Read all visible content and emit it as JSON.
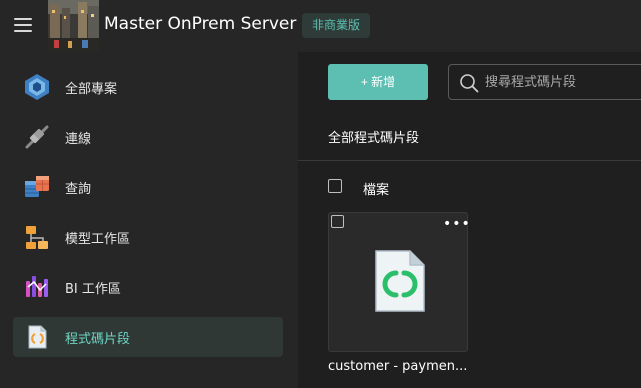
{
  "header": {
    "menu_icon": "hamburger-menu-icon",
    "server_title": "Master OnPrem Server",
    "badge": "非商業版"
  },
  "sidebar": {
    "items": [
      {
        "label": "全部專案",
        "icon": "all-projects-icon",
        "active": false
      },
      {
        "label": "連線",
        "icon": "connection-plug-icon",
        "active": false
      },
      {
        "label": "查詢",
        "icon": "query-table-icon",
        "active": false
      },
      {
        "label": "模型工作區",
        "icon": "model-workspace-icon",
        "active": false
      },
      {
        "label": "BI 工作區",
        "icon": "bi-workspace-icon",
        "active": false
      },
      {
        "label": "程式碼片段",
        "icon": "code-snippet-icon",
        "active": true
      }
    ]
  },
  "main": {
    "new_button": "+ 新增",
    "search": {
      "placeholder": "搜尋程式碼片段",
      "value": ""
    },
    "section_title": "全部程式碼片段",
    "column_header": "檔案",
    "cards": [
      {
        "name": "customer - paymen...",
        "icon": "code-snippet-file-icon",
        "menu": "•••"
      }
    ]
  },
  "colors": {
    "accent": "#5cbfb1",
    "active_text": "#6fd4c4",
    "background": "#1f1f1f",
    "sidebar": "#262626"
  }
}
